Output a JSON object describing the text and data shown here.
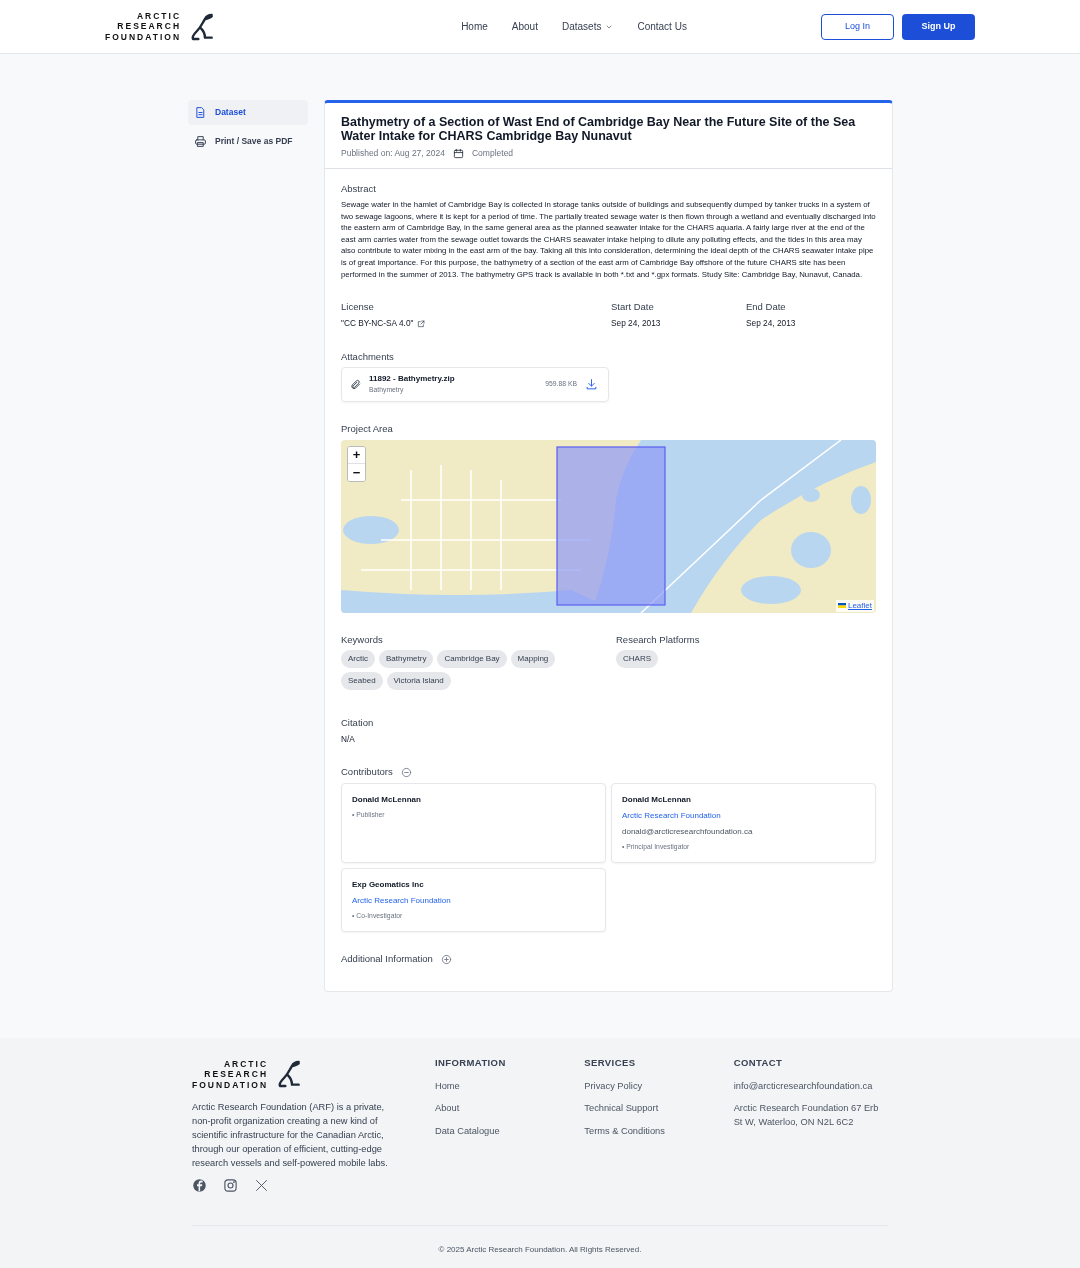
{
  "header": {
    "logo_lines": [
      "ARCTIC",
      "RESEARCH",
      "FOUNDATION"
    ],
    "nav": [
      {
        "label": "Home",
        "dropdown": false
      },
      {
        "label": "About",
        "dropdown": false
      },
      {
        "label": "Datasets",
        "dropdown": true
      },
      {
        "label": "Contact Us",
        "dropdown": false
      }
    ],
    "login": "Log In",
    "signup": "Sign Up"
  },
  "sidebar": {
    "items": [
      {
        "label": "Dataset",
        "selected": true
      },
      {
        "label": "Print / Save as PDF",
        "selected": false
      }
    ]
  },
  "dataset": {
    "title": "Bathymetry of a Section of Wast End of Cambridge Bay Near the Future Site of the Sea Water Intake for CHARS Cambridge Bay Nunavut",
    "published": "Published on: Aug 27, 2024",
    "status": "Completed",
    "abstract_label": "Abstract",
    "abstract": "Sewage water in the hamlet of Cambridge Bay is collected in storage tanks outside of buildings and subsequently dumped by tanker trucks in a system of two sewage lagoons, where it is kept for a period of time. The partially treated sewage water is then flown through a wetland and eventually discharged into the eastern arm of Cambridge Bay, in the same general area as the planned seawater intake for the CHARS aquaria. A fairly large river at the end of the east arm carries water from the sewage outlet towards the CHARS seawater intake helping to dilute any polluting effects, and the tides in this area may also contribute to water mixing in the east arm of the bay. Taking all this into consideration, determining the ideal depth of the CHARS seawater intake pipe is of great importance. For this purpose, the bathymetry of a section of the east arm of Cambridge Bay offshore of the future CHARS site has been performed in the summer of 2013. The bathymetry GPS track is available in both *.txt and *.gpx formats. Study Site: Cambridge Bay, Nunavut, Canada.",
    "license_label": "License",
    "license": "\"CC BY-NC-SA 4.0\"",
    "start_label": "Start Date",
    "start": "Sep 24, 2013",
    "end_label": "End Date",
    "end": "Sep 24, 2013",
    "attachments_label": "Attachments",
    "attachments": [
      {
        "name": "11892 - Bathymetry.zip",
        "description": "Bathymetry",
        "size": "959.88 KB"
      }
    ],
    "area_label": "Project Area",
    "map": {
      "zoom_in": "+",
      "zoom_out": "−",
      "attribution": "Leaflet"
    },
    "keywords_label": "Keywords",
    "keywords": [
      "Arctic",
      "Bathymetry",
      "Cambridge Bay",
      "Mapping",
      "Seabed",
      "Victoria Island"
    ],
    "platforms_label": "Research Platforms",
    "platforms": [
      "CHARS"
    ],
    "citation_label": "Citation",
    "citation": "N/A",
    "contributors_label": "Contributors",
    "contributors_expanded": true,
    "contributors": [
      {
        "name": "Donald McLennan",
        "role": "• Publisher"
      },
      {
        "name": "Donald McLennan",
        "organization": "Arctic Research Foundation",
        "email": "donald@arcticresearchfoundation.ca",
        "role": "• Principal Investigator"
      },
      {
        "name": "Exp Geomatics Inc",
        "organization": "Arctic Research Foundation",
        "role": "• Co-Investigator"
      }
    ],
    "additional_label": "Additional Information",
    "additional_expanded": false
  },
  "footer": {
    "about": "Arctic Research Foundation (ARF) is a private, non-profit organization creating a new kind of scientific infrastructure for the Canadian Arctic, through our operation of efficient, cutting-edge research vessels and self-powered mobile labs.",
    "logo_lines": [
      "ARCTIC",
      "RESEARCH",
      "FOUNDATION"
    ],
    "columns": [
      {
        "heading": "INFORMATION",
        "links": [
          "Home",
          "About",
          "Data Catalogue"
        ]
      },
      {
        "heading": "SERVICES",
        "links": [
          "Privacy Policy",
          "Technical Support",
          "Terms & Conditions"
        ]
      },
      {
        "heading": "CONTACT",
        "links": [
          "info@arcticresearchfoundation.ca",
          "Arctic Research Foundation 67 Erb St W, Waterloo, ON N2L 6C2"
        ]
      }
    ],
    "copyright": "© 2025 Arctic Research Foundation. All Rights Reserved."
  }
}
